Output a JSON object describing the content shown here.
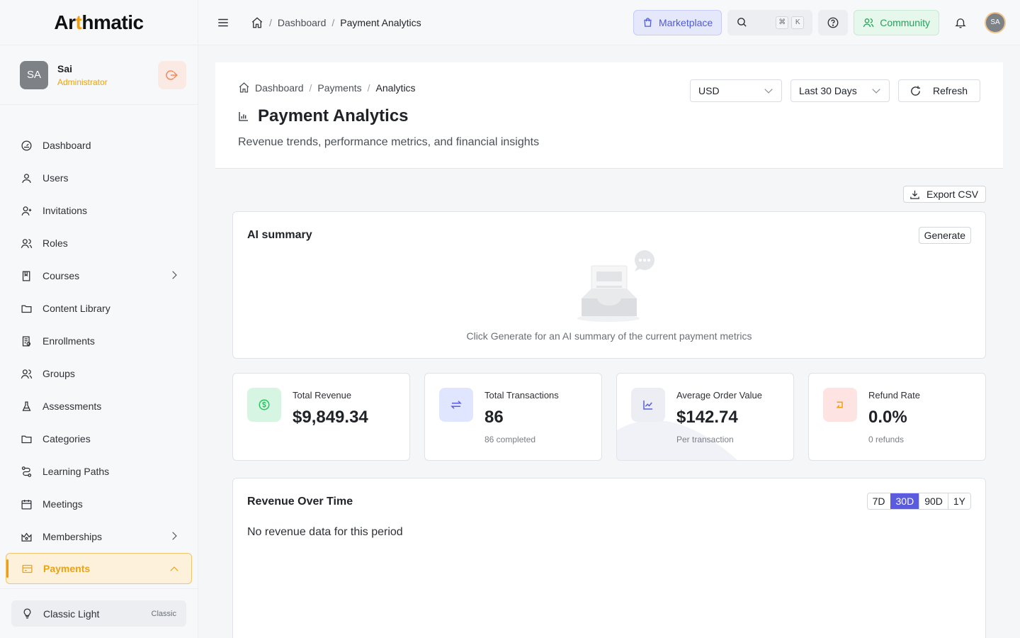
{
  "brand": {
    "logo_text_a": "Ar",
    "logo_text_accent": "t",
    "logo_text_b": "hmatic"
  },
  "user": {
    "initials": "SA",
    "name": "Sai",
    "role": "Administrator"
  },
  "sidebar": {
    "items": [
      {
        "label": "Dashboard",
        "icon": "gauge-icon"
      },
      {
        "label": "Users",
        "icon": "user-icon"
      },
      {
        "label": "Invitations",
        "icon": "user-plus-icon"
      },
      {
        "label": "Roles",
        "icon": "users-icon"
      },
      {
        "label": "Courses",
        "icon": "book-icon",
        "expandable": true
      },
      {
        "label": "Content Library",
        "icon": "folder-icon"
      },
      {
        "label": "Enrollments",
        "icon": "clipboard-icon"
      },
      {
        "label": "Groups",
        "icon": "users-icon"
      },
      {
        "label": "Assessments",
        "icon": "flask-icon"
      },
      {
        "label": "Categories",
        "icon": "folder-icon"
      },
      {
        "label": "Learning Paths",
        "icon": "route-icon"
      },
      {
        "label": "Meetings",
        "icon": "calendar-icon"
      },
      {
        "label": "Memberships",
        "icon": "crown-icon",
        "expandable": true
      },
      {
        "label": "Payments",
        "icon": "credit-card-icon",
        "active": true,
        "expanded": true
      }
    ],
    "theme": {
      "label": "Classic Light",
      "tag": "Classic"
    }
  },
  "topbar": {
    "crumbs": [
      "Dashboard",
      "Payment Analytics"
    ],
    "marketplace": "Marketplace",
    "kbd1": "⌘",
    "kbd2": "K",
    "community": "Community",
    "avatar": "SA"
  },
  "header": {
    "crumbs": [
      "Dashboard",
      "Payments",
      "Analytics"
    ],
    "title": "Payment Analytics",
    "subtitle": "Revenue trends, performance metrics, and financial insights",
    "currency": "USD",
    "range": "Last 30 Days",
    "refresh": "Refresh"
  },
  "export_label": "Export CSV",
  "ai": {
    "title": "AI summary",
    "generate": "Generate",
    "empty": "Click Generate for an AI summary of the current payment metrics"
  },
  "stats": [
    {
      "label": "Total Revenue",
      "value": "$9,849.34",
      "note": "",
      "icon": "dollar-icon",
      "color": "#22c55e",
      "bg": "#d7f5e3"
    },
    {
      "label": "Total Transactions",
      "value": "86",
      "note": "86 completed",
      "icon": "transfer-icon",
      "color": "#5b5be0",
      "bg": "#dfe6fd"
    },
    {
      "label": "Average Order Value",
      "value": "$142.74",
      "note": "Per transaction",
      "icon": "chart-line-icon",
      "color": "#5b5be0",
      "bg": "#eceef3"
    },
    {
      "label": "Refund Rate",
      "value": "0.0%",
      "note": "0 refunds",
      "icon": "refund-icon",
      "color": "#f59e0b",
      "bg": "#fde3e1"
    }
  ],
  "revenue": {
    "title": "Revenue Over Time",
    "ranges": [
      "7D",
      "30D",
      "90D",
      "1Y"
    ],
    "selected_range": "30D",
    "empty": "No revenue data for this period"
  }
}
